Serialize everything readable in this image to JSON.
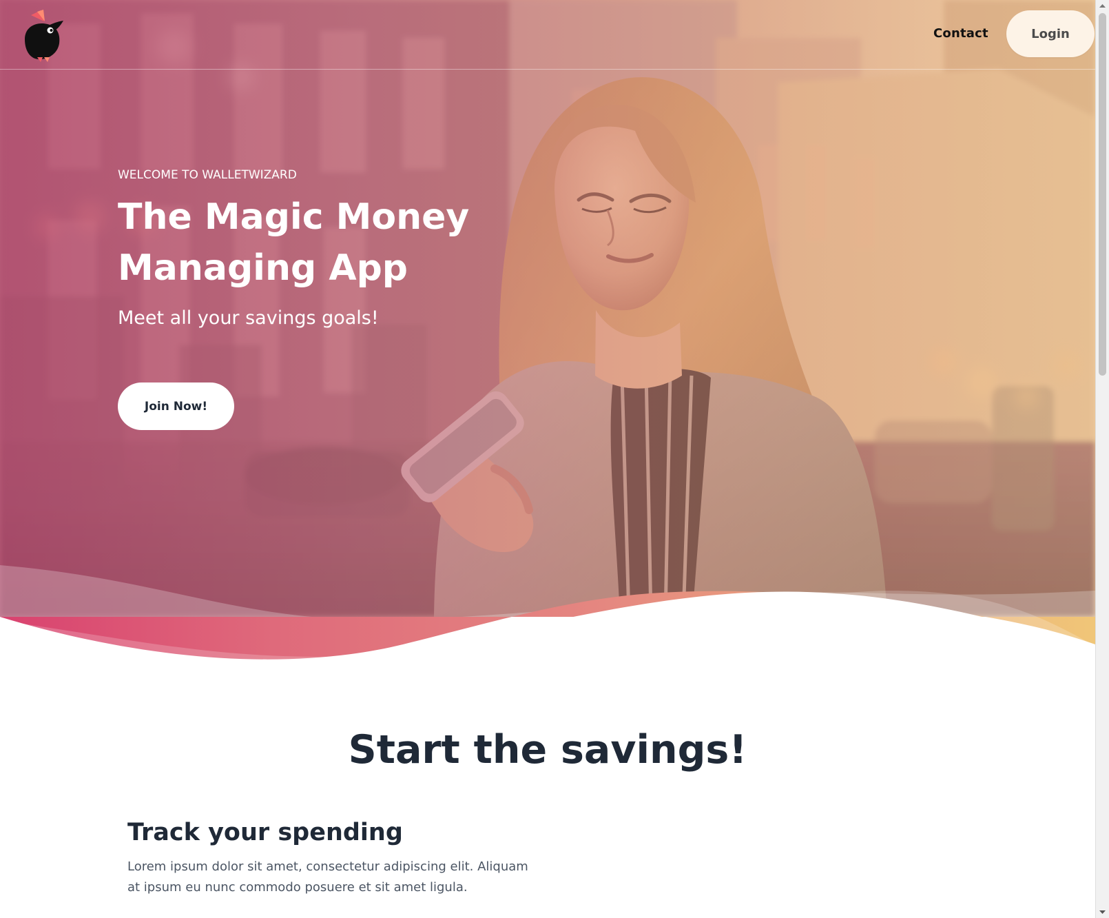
{
  "navigation": {
    "contact_label": "Contact",
    "login_label": "Login"
  },
  "hero": {
    "eyebrow": "WELCOME TO WALLETWIZARD",
    "title_line_1": "The Magic Money",
    "title_line_2": "Managing App",
    "subtitle": "Meet all your savings goals!",
    "cta_label": "Join Now!"
  },
  "savings_section": {
    "title": "Start the savings!",
    "feature_title": "Track your spending",
    "feature_copy": "Lorem ipsum dolor sit amet, consectetur adipiscing elit. Aliquam at ipsum eu nunc commodo posuere et sit amet ligula."
  },
  "colors": {
    "gradient_start": "#d9426f",
    "gradient_middle": "#e27e83",
    "gradient_end": "#f0c678",
    "heading_text": "#1f2937",
    "body_text": "#4b5563"
  },
  "icons": {
    "logo": "wizard-bird-logo",
    "scroll_up": "scroll-up-icon",
    "scroll_down": "scroll-down-icon"
  }
}
